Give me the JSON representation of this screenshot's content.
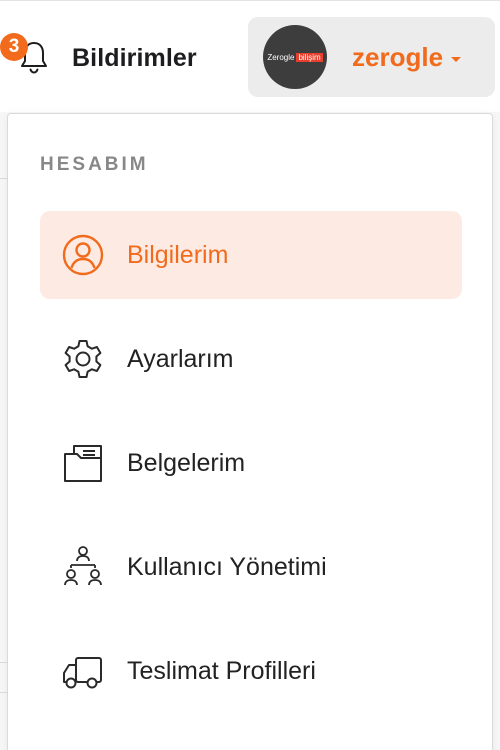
{
  "header": {
    "notifications": {
      "badge_count": "3",
      "label": "Bildirimler"
    },
    "user": {
      "avatar_text_left": "Zerogle",
      "avatar_text_right": "bilişim",
      "name": "zerogle"
    }
  },
  "menu": {
    "section_title": "HESABIM",
    "items": [
      {
        "label": "Bilgilerim",
        "icon": "user-circle-icon",
        "active": true
      },
      {
        "label": "Ayarlarım",
        "icon": "gear-icon",
        "active": false
      },
      {
        "label": "Belgelerim",
        "icon": "folder-icon",
        "active": false
      },
      {
        "label": "Kullanıcı Yönetimi",
        "icon": "users-hierarchy-icon",
        "active": false
      },
      {
        "label": "Teslimat Profilleri",
        "icon": "truck-icon",
        "active": false
      }
    ]
  },
  "colors": {
    "accent": "#f26b1d",
    "active_bg": "#fdebe3",
    "text": "#222222",
    "muted": "#888888"
  }
}
